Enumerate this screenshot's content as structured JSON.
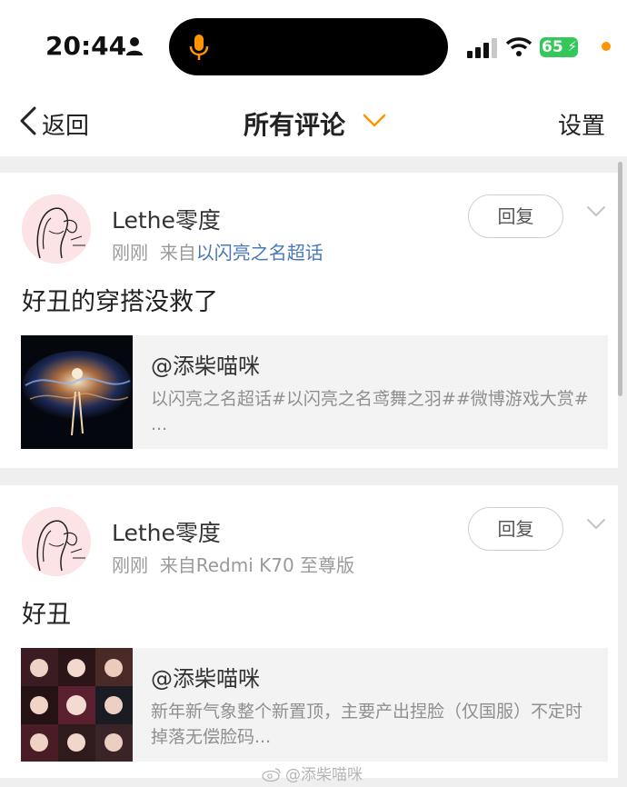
{
  "status_bar": {
    "time": "20:44",
    "battery": "65"
  },
  "nav": {
    "back_label": "返回",
    "title": "所有评论",
    "settings_label": "设置"
  },
  "comments": [
    {
      "username": "Lethe零度",
      "time": "刚刚",
      "source_prefix": "来自",
      "source": "以闪亮之名超话",
      "source_is_link": true,
      "reply_label": "回复",
      "text": "好丑的穿搭没救了",
      "share": {
        "author": "@添柴喵咪",
        "desc": "以闪亮之名超话#以闪亮之名鸢舞之羽##微博游戏大赏# ..."
      }
    },
    {
      "username": "Lethe零度",
      "time": "刚刚",
      "source_prefix": "来自",
      "source": "Redmi K70 至尊版",
      "source_is_link": false,
      "reply_label": "回复",
      "text": "好丑",
      "share": {
        "author": "@添柴喵咪",
        "desc": "新年新气象整个新置顶，主要产出捏脸（仅国服）不定时掉落无偿脸码..."
      }
    }
  ],
  "watermark": "@添柴喵咪",
  "colors": {
    "link": "#4a78b8",
    "accent": "#ff9500",
    "battery": "#34c759"
  },
  "icons": [
    "person-icon",
    "microphone-icon",
    "signal-icon",
    "wifi-icon",
    "back-chevron-icon",
    "chevron-down-icon",
    "weibo-icon"
  ]
}
